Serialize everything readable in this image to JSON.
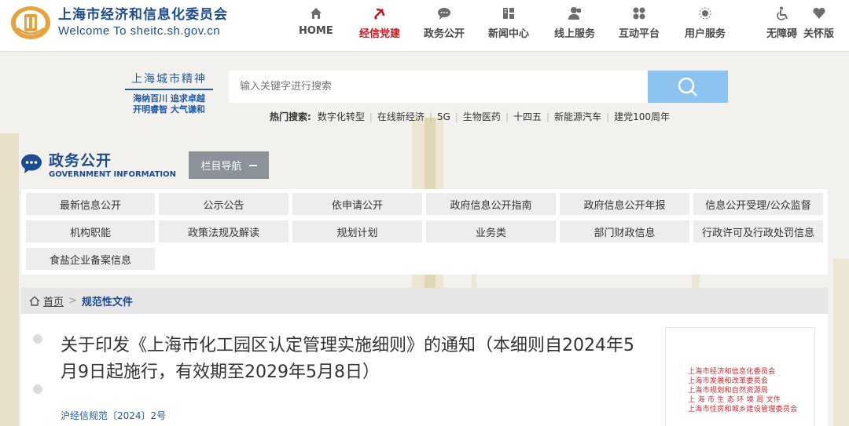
{
  "header": {
    "site_name_cn": "上海市经济和信息化委员会",
    "site_name_en": "Welcome To sheitc.sh.gov.cn",
    "nav": [
      {
        "label": "HOME",
        "icon": "home-icon"
      },
      {
        "label": "经信党建",
        "icon": "party-emblem-icon",
        "active": true
      },
      {
        "label": "政务公开",
        "icon": "chat-bubble-icon"
      },
      {
        "label": "新闻中心",
        "icon": "news-icon"
      },
      {
        "label": "线上服务",
        "icon": "user-service-icon"
      },
      {
        "label": "互动平台",
        "icon": "interaction-icon"
      },
      {
        "label": "用户服务",
        "icon": "sun-icon"
      },
      {
        "label": "无障碍",
        "icon": "wheelchair-icon"
      },
      {
        "label": "关怀版",
        "icon": "heart-icon"
      }
    ],
    "colors": {
      "brand": "#1c4b8f",
      "active": "#c8161d"
    }
  },
  "banner": {
    "spirit_title": "上海城市精神",
    "spirit_line1": "海纳百川 追求卓越",
    "spirit_line2": "开明睿智 大气谦和",
    "search_placeholder": "输入关键字进行搜索",
    "search_button_color": "#8cc4ef",
    "hot_label": "热门搜索:",
    "hot_keywords": [
      "数字化转型",
      "在线新经济",
      "5G",
      "生物医药",
      "十四五",
      "新能源汽车",
      "建党100周年"
    ]
  },
  "gov_open": {
    "title_cn": "政务公开",
    "title_en": "GOVERNMENT INFORMATION",
    "column_nav_label": "栏目导航",
    "items": [
      "最新信息公开",
      "公示公告",
      "依申请公开",
      "政府信息公开指南",
      "政府信息公开年报",
      "信息公开受理/公众监督",
      "机构职能",
      "政策法规及解读",
      "规划计划",
      "业务类",
      "部门财政信息",
      "行政许可及行政处罚信息",
      "食盐企业备案信息"
    ]
  },
  "breadcrumb": {
    "home": "首页",
    "current": "规范性文件"
  },
  "document": {
    "title": "关于印发《上海市化工园区认定管理实施细则》的通知（本细则自2024年5月9日起施行，有效期至2029年5月8日）",
    "number": "沪经信规范〔2024〕2号",
    "issuers": [
      "上海市经济和信息化委员会",
      "上海市发展和改革委员会",
      "上海市规划和自然资源局",
      "上 海 市 生 态 环 境 局  文件",
      "上海市住房和城乡建设管理委员会"
    ]
  }
}
